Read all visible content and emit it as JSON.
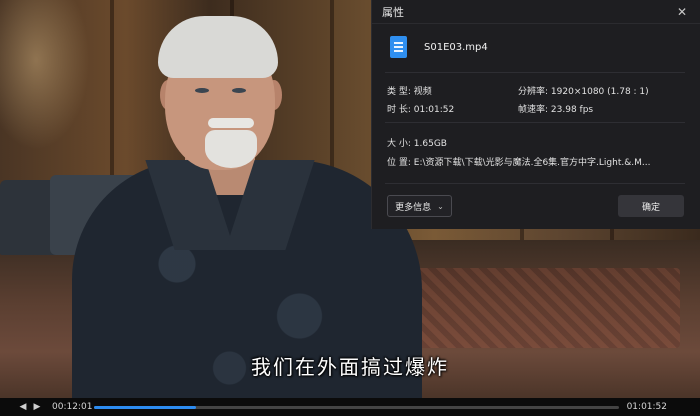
{
  "video": {
    "subtitle": "我们在外面搞过爆炸"
  },
  "player": {
    "prev_icon": "◀",
    "next_icon": "▶",
    "current_time": "00:12:01",
    "total_time": "01:01:52",
    "progress_fraction": 0.195,
    "accent_color": "#2d8cf0"
  },
  "dialog": {
    "title": "属性",
    "close_icon": "✕",
    "file_name": "S01E03.mp4",
    "props": {
      "type_label": "类 型:",
      "type_value": "视频",
      "resolution_label": "分辨率:",
      "resolution_value": "1920×1080 (1.78 : 1)",
      "duration_label": "时 长:",
      "duration_value": "01:01:52",
      "framerate_label": "帧速率:",
      "framerate_value": "23.98 fps",
      "size_label": "大 小:",
      "size_value": "1.65GB",
      "location_label": "位 置:",
      "location_value": "E:\\资源下载\\下载\\光影与魔法.全6集.官方中字.Light.&.M..."
    },
    "more_info_label": "更多信息",
    "chevron_icon": "⌄",
    "ok_label": "确定",
    "file_icon_color": "#2f8ff0"
  }
}
